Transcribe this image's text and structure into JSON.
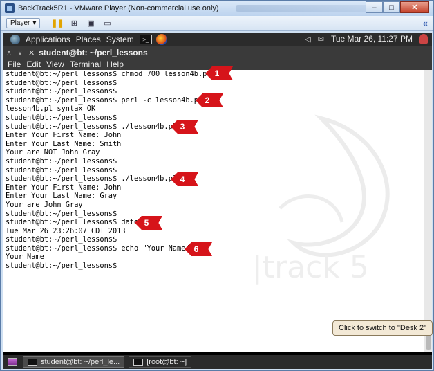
{
  "vm": {
    "title": "BackTrack5R1 - VMware Player (Non-commercial use only)",
    "player_label": "Player",
    "window_buttons": [
      "–",
      "□",
      "✕"
    ],
    "toolbar_right": "«"
  },
  "guest_panel": {
    "menus": [
      "Applications",
      "Places",
      "System"
    ],
    "datetime": "Tue Mar 26, 11:27 PM"
  },
  "terminal": {
    "tab_title": "student@bt: ~/perl_lessons",
    "menu": [
      "File",
      "Edit",
      "View",
      "Terminal",
      "Help"
    ],
    "lines": [
      "student@bt:~/perl_lessons$ chmod 700 lesson4b.pl",
      "student@bt:~/perl_lessons$",
      "student@bt:~/perl_lessons$",
      "student@bt:~/perl_lessons$ perl -c lesson4b.pl",
      "lesson4b.pl syntax OK",
      "student@bt:~/perl_lessons$",
      "student@bt:~/perl_lessons$ ./lesson4b.pl",
      "Enter Your First Name: John",
      "Enter Your Last Name: Smith",
      "Your are NOT John Gray",
      "student@bt:~/perl_lessons$",
      "student@bt:~/perl_lessons$",
      "student@bt:~/perl_lessons$ ./lesson4b.pl",
      "Enter Your First Name: John",
      "Enter Your Last Name: Gray",
      "Your are John Gray",
      "student@bt:~/perl_lessons$",
      "student@bt:~/perl_lessons$ date",
      "Tue Mar 26 23:26:07 CDT 2013",
      "student@bt:~/perl_lessons$",
      "student@bt:~/perl_lessons$ echo \"Your Name\"",
      "Your Name",
      "student@bt:~/perl_lessons$"
    ]
  },
  "annotations": [
    "1",
    "2",
    "3",
    "4",
    "5",
    "6"
  ],
  "taskbar": {
    "tasks": [
      "student@bt: ~/perl_le...",
      "[root@bt: ~]"
    ],
    "tooltip": "Click to switch to \"Desk 2\""
  },
  "colors": {
    "annotation_red": "#d6141a",
    "panel_bg": "#2b2b2b"
  }
}
